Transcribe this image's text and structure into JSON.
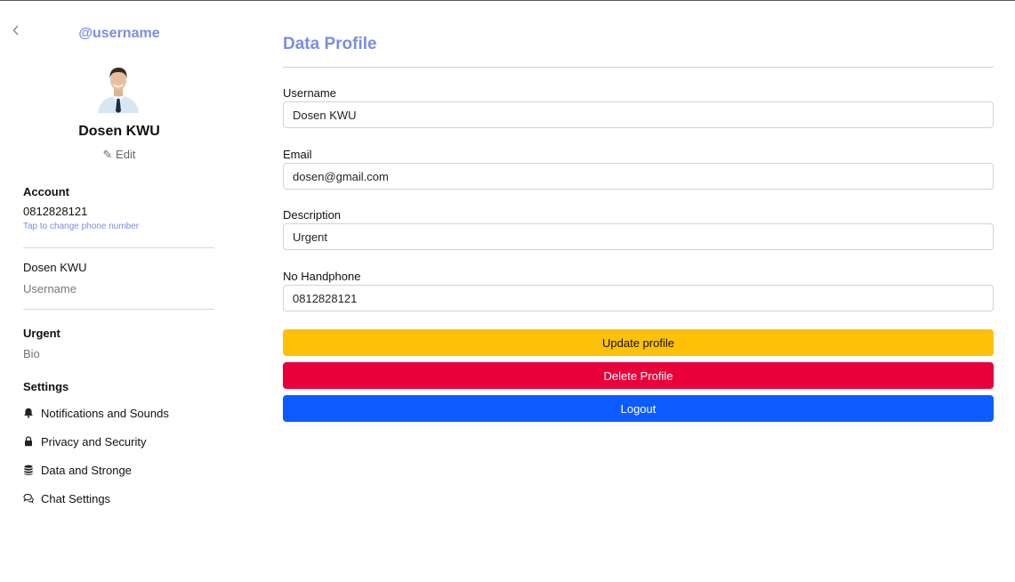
{
  "sidebar": {
    "back_icon": "chevron-left-icon",
    "handle": "@username",
    "avatar_icon": "user-avatar",
    "name": "Dosen KWU",
    "edit_label": "✎ Edit",
    "account": {
      "title": "Account",
      "phone": "0812828121",
      "phone_hint": "Tap to change phone number"
    },
    "username_section": {
      "value": "Dosen KWU",
      "label": "Username"
    },
    "bio_section": {
      "value": "Urgent",
      "label": "Bio"
    },
    "settings": {
      "title": "Settings",
      "items": [
        {
          "label": "Notifications and Sounds",
          "icon": "bell-icon"
        },
        {
          "label": "Privacy and Security",
          "icon": "lock-icon"
        },
        {
          "label": "Data and Stronge",
          "icon": "database-icon"
        },
        {
          "label": "Chat Settings",
          "icon": "chat-icon"
        }
      ]
    }
  },
  "main": {
    "title": "Data Profile",
    "fields": [
      {
        "label": "Username",
        "value": "Dosen KWU"
      },
      {
        "label": "Email",
        "value": "dosen@gmail.com"
      },
      {
        "label": "Description",
        "value": "Urgent"
      },
      {
        "label": "No Handphone",
        "value": "0812828121"
      }
    ],
    "buttons": {
      "update": "Update profile",
      "delete": "Delete Profile",
      "logout": "Logout"
    }
  },
  "colors": {
    "accent": "#7a8fe0",
    "warning": "#ffc107",
    "danger": "#e8003a",
    "primary": "#0d5cff"
  }
}
